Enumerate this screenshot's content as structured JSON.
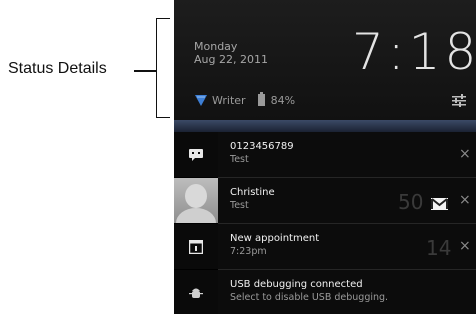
{
  "annotation": {
    "label": "Status Details"
  },
  "status": {
    "day": "Monday",
    "date": "Aug 22, 2011",
    "clock": "7:18",
    "network": "Writer",
    "battery": "84%"
  },
  "notifications": [
    {
      "title": "0123456789",
      "subtitle": "Test",
      "icon": "sms-icon",
      "time": ""
    },
    {
      "title": "Christine",
      "subtitle": "Test",
      "icon": "contact-avatar",
      "time": "50"
    },
    {
      "title": "New appointment",
      "subtitle": "7:23pm",
      "icon": "calendar-icon",
      "time": "14"
    },
    {
      "title": "USB debugging connected",
      "subtitle": "Select to disable USB debugging.",
      "icon": "android-debug-icon",
      "time": ""
    }
  ],
  "close_label": "×",
  "colors": {
    "screen_bg": "#000000",
    "accent_wifi": "#3d7fd6",
    "separator": "#3b4a66"
  }
}
